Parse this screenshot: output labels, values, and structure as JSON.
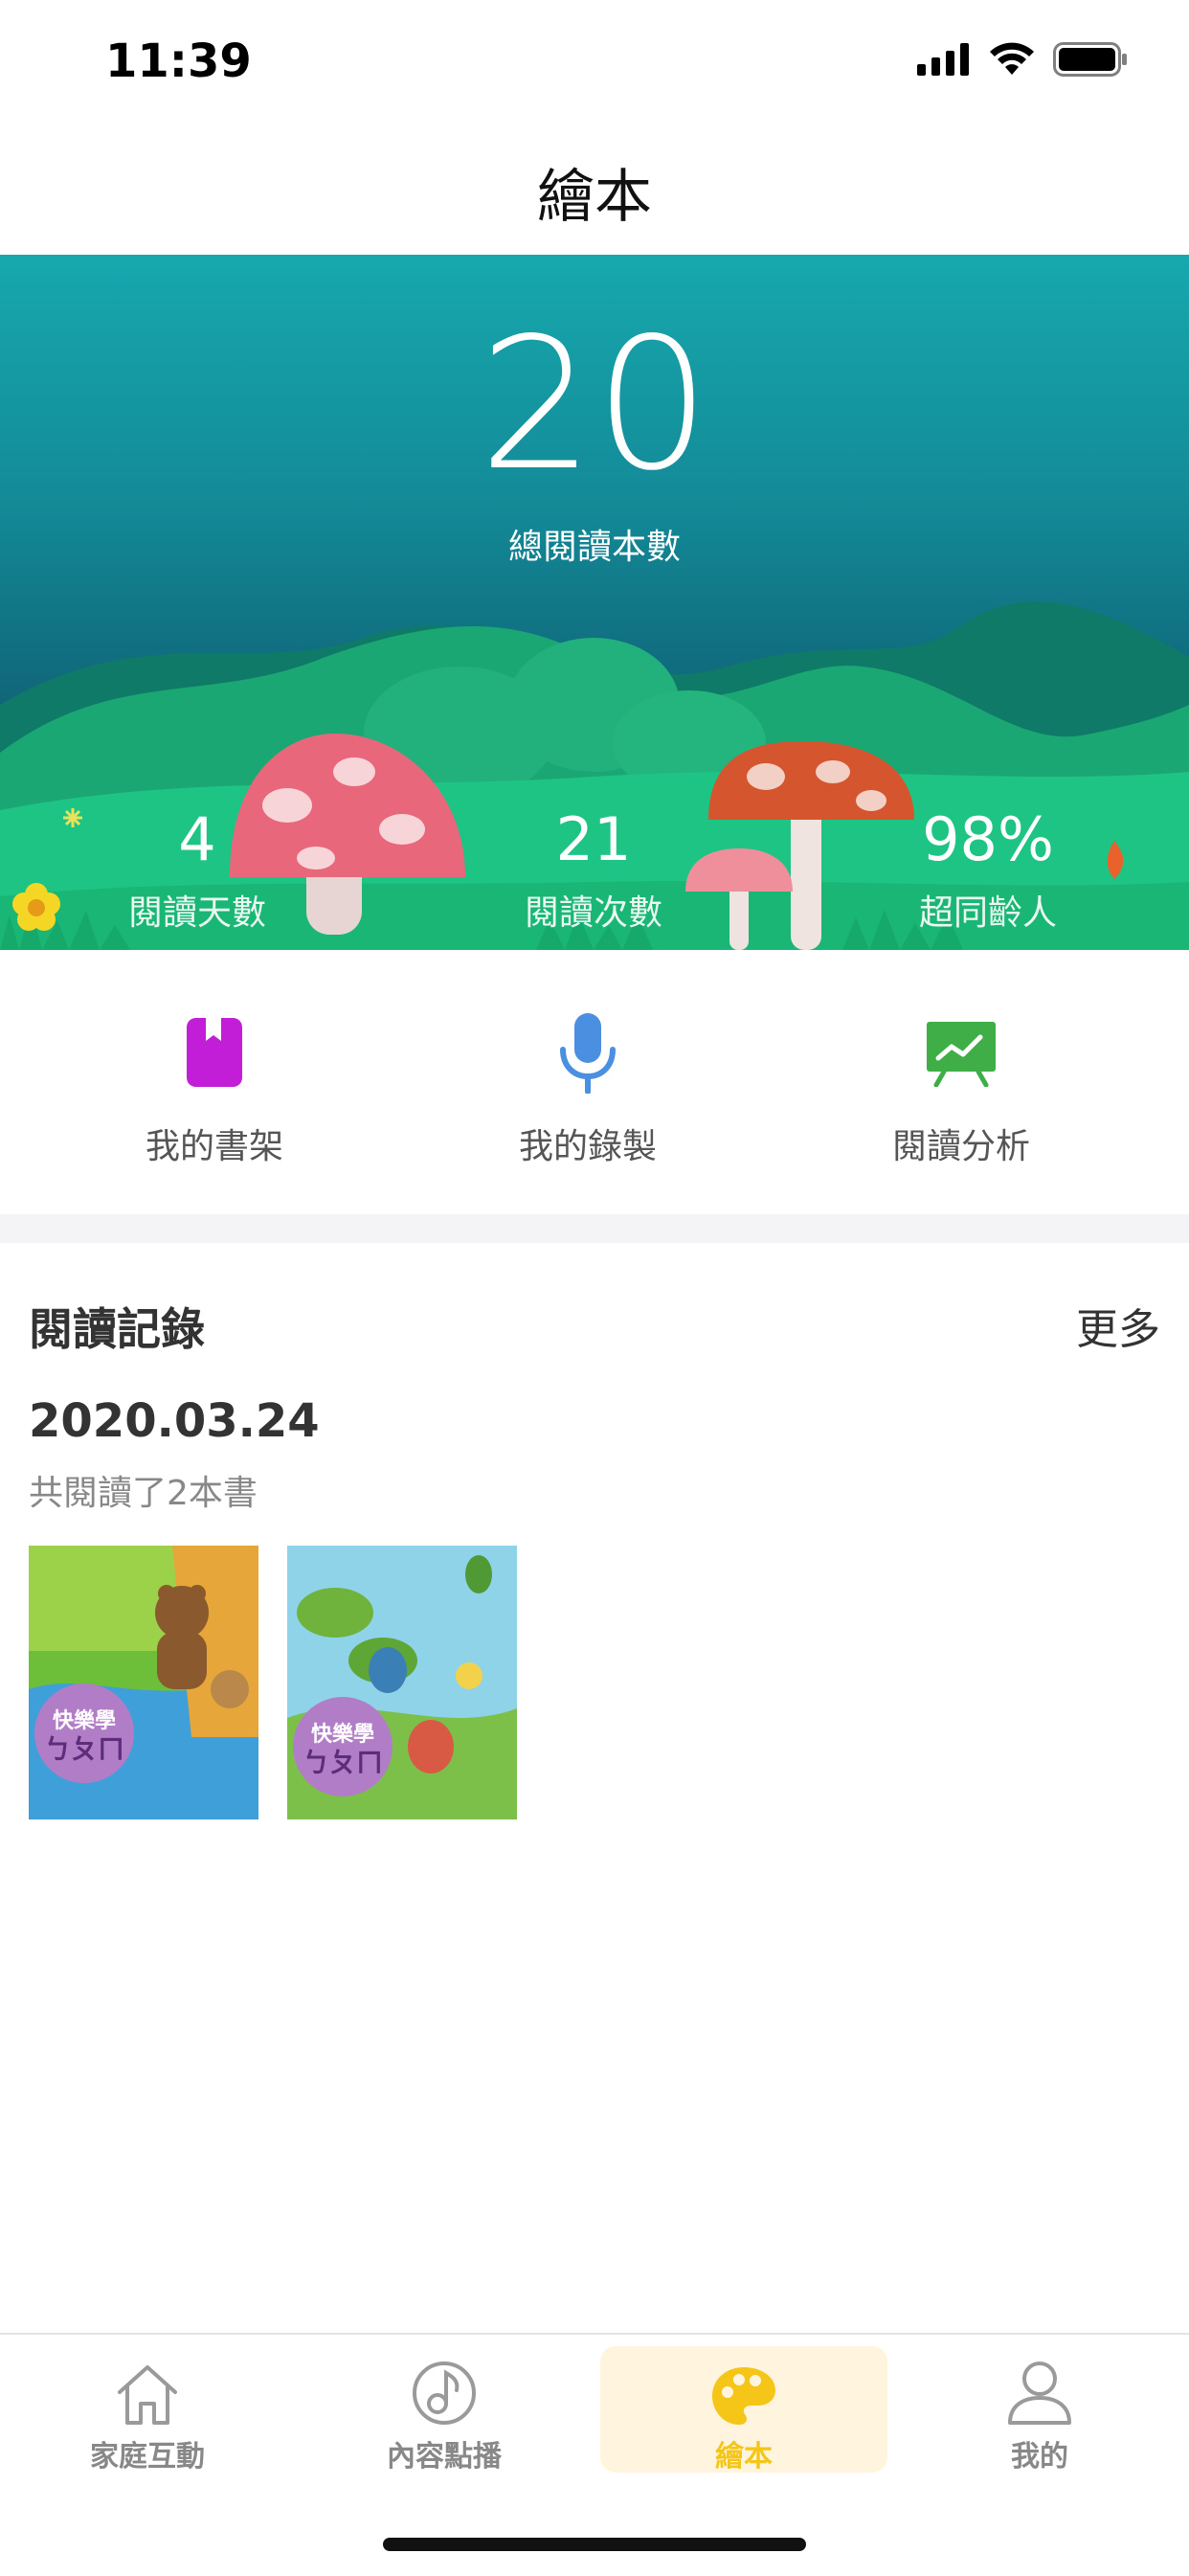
{
  "status_bar": {
    "time": "11:39"
  },
  "nav": {
    "title": "繪本"
  },
  "hero": {
    "total_value": "20",
    "total_label": "總閱讀本數",
    "stats": [
      {
        "value": "4",
        "label": "閱讀天數"
      },
      {
        "value": "21",
        "label": "閱讀次數"
      },
      {
        "value": "98%",
        "label": "超同齡人"
      }
    ]
  },
  "quick_actions": [
    {
      "label": "我的書架",
      "icon": "bookshelf-icon",
      "color": "#c21ed8"
    },
    {
      "label": "我的錄製",
      "icon": "microphone-icon",
      "color": "#4a8fe0"
    },
    {
      "label": "閱讀分析",
      "icon": "chart-board-icon",
      "color": "#3fae46"
    }
  ],
  "records": {
    "title": "閱讀記錄",
    "more": "更多",
    "date": "2020.03.24",
    "count_text": "共閱讀了2本書",
    "books": [
      {
        "title": "快樂學",
        "subtitle": "ㄅㄆㄇ",
        "theme": "bear"
      },
      {
        "title": "快樂學",
        "subtitle": "ㄅㄆㄇ",
        "theme": "bugs"
      }
    ]
  },
  "tabbar": {
    "items": [
      {
        "label": "家庭互動",
        "icon": "house-icon"
      },
      {
        "label": "內容點播",
        "icon": "music-note-icon"
      },
      {
        "label": "繪本",
        "icon": "palette-icon",
        "active": true
      },
      {
        "label": "我的",
        "icon": "person-icon"
      }
    ],
    "active_color": "#f5c518"
  }
}
